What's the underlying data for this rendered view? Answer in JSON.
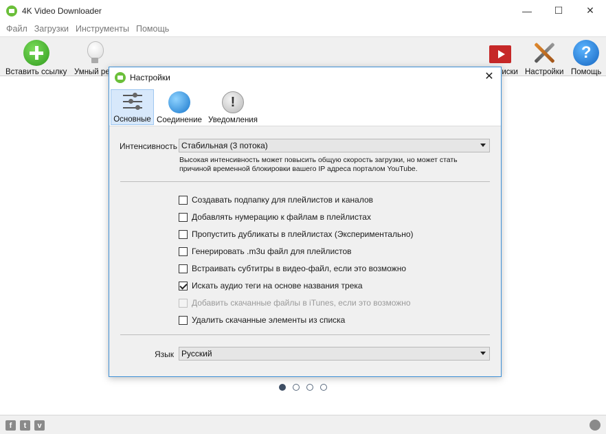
{
  "window": {
    "title": "4K Video Downloader"
  },
  "menu": [
    "Файл",
    "Загрузки",
    "Инструменты",
    "Помощь"
  ],
  "toolbar": {
    "paste_link": "Вставить ссылку",
    "smart_mode": "Умный реж",
    "subscriptions": "Подписки",
    "settings": "Настройки",
    "help": "Помощь"
  },
  "dialog": {
    "title": "Настройки",
    "tabs": [
      "Основные",
      "Соединение",
      "Уведомления"
    ],
    "active_tab": "Основные",
    "intensity": {
      "label": "Интенсивность",
      "value": "Стабильная (3 потока)",
      "hint_line1": "Высокая интенсивность может повысить общую скорость загрузки, но может стать",
      "hint_line2": "причиной временной блокировки вашего IP адреса порталом YouTube."
    },
    "options": [
      {
        "label": "Создавать подпапку для плейлистов и каналов",
        "checked": false,
        "disabled": false
      },
      {
        "label": "Добавлять нумерацию к файлам в плейлистах",
        "checked": false,
        "disabled": false
      },
      {
        "label": "Пропустить дубликаты в плейлистах (Экспериментально)",
        "checked": false,
        "disabled": false
      },
      {
        "label": "Генерировать .m3u файл для плейлистов",
        "checked": false,
        "disabled": false
      },
      {
        "label": "Встраивать субтитры в видео-файл, если это возможно",
        "checked": false,
        "disabled": false
      },
      {
        "label": "Искать аудио теги на основе названия трека",
        "checked": true,
        "disabled": false
      },
      {
        "label": "Добавить скачанные файлы в iTunes, если это возможно",
        "checked": false,
        "disabled": true
      },
      {
        "label": "Удалить скачанные элементы из списка",
        "checked": false,
        "disabled": false
      }
    ],
    "language": {
      "label": "Язык",
      "value": "Русский"
    }
  },
  "pager": {
    "total": 4,
    "current": 1
  },
  "social": [
    "f",
    "t",
    "v"
  ]
}
